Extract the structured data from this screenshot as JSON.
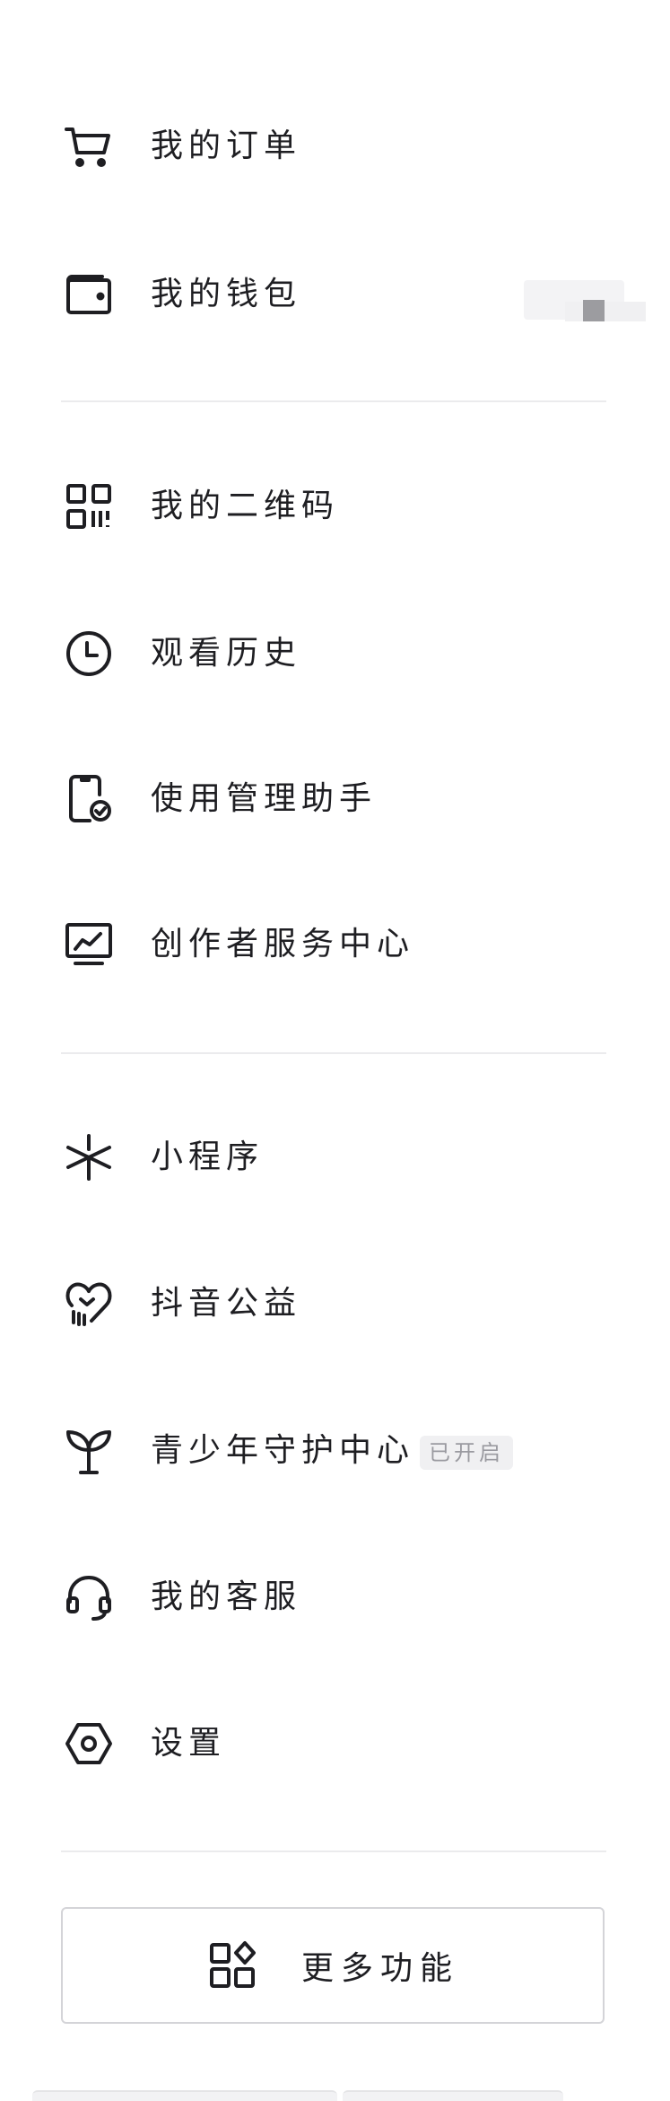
{
  "menu": {
    "orders": "我的订单",
    "wallet": "我的钱包",
    "qrcode": "我的二维码",
    "history": "观看历史",
    "usage": "使用管理助手",
    "creator": "创作者服务中心",
    "miniprogram": "小程序",
    "charity": "抖音公益",
    "youth": "青少年守护中心",
    "youth_badge": "已开启",
    "service": "我的客服",
    "settings": "设置"
  },
  "more": {
    "label": "更多功能"
  },
  "icons": {
    "orders": "cart-icon",
    "wallet": "wallet-icon",
    "qrcode": "qr-code-icon",
    "history": "clock-icon",
    "usage": "phone-check-icon",
    "creator": "monitor-chart-icon",
    "miniprogram": "asterisk-icon",
    "charity": "heart-hand-icon",
    "youth": "sprout-icon",
    "service": "headset-icon",
    "settings": "hexagon-gear-icon",
    "more": "grid-shapes-icon"
  },
  "colors": {
    "text": "#1e1e22",
    "divider": "#ebebed",
    "badge_bg": "#f0f0f2",
    "badge_text": "#9a9aa0"
  }
}
